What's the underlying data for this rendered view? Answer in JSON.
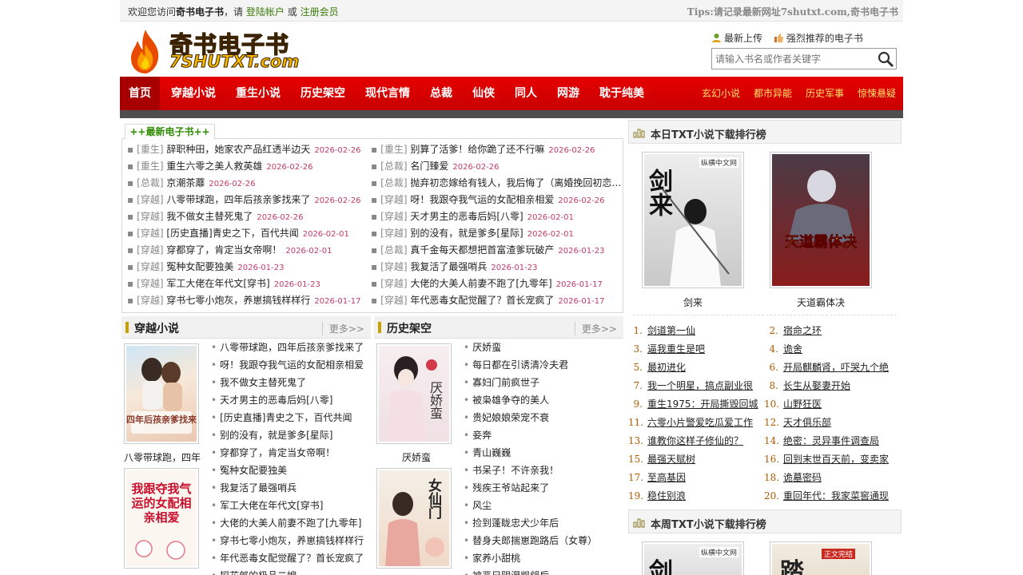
{
  "topbar": {
    "welcome_prefix": "欢迎您访问",
    "site_name": "奇书电子书",
    "welcome_mid": "，请",
    "login": "登陆帐户",
    "or": "或",
    "register": "注册会员",
    "tips": "Tips:请记录最新网址7shutxt.com,奇书电子书"
  },
  "logo": {
    "line1": "奇书电子书",
    "line2": "7SHUTXT.com"
  },
  "header_links": {
    "latest_upload": "最新上传",
    "recommended": "强烈推荐的电子书"
  },
  "search": {
    "placeholder": "请输入书名或作者关键字"
  },
  "nav": {
    "items": [
      "首页",
      "穿越小说",
      "重生小说",
      "历史架空",
      "现代言情",
      "总裁",
      "仙侠",
      "同人",
      "网游",
      "耽于纯美"
    ],
    "extra": [
      "玄幻小说",
      "都市异能",
      "历史军事",
      "惊悚悬疑"
    ]
  },
  "latest": {
    "tab": "++最新电子书++",
    "rows": [
      [
        {
          "cat": "[重生]",
          "title": "辞职种田，她家农产品红透半边天",
          "date": "2026-02-26"
        },
        {
          "cat": "[重生]",
          "title": "别算了活爹！给你跪了还不行嘛",
          "date": "2026-02-26"
        }
      ],
      [
        {
          "cat": "[重生]",
          "title": "重生六零之美人救英雄",
          "date": "2026-02-26"
        },
        {
          "cat": "[总裁]",
          "title": "名门臻爱",
          "date": "2026-02-26"
        }
      ],
      [
        {
          "cat": "[总裁]",
          "title": "京潮茶蘼",
          "date": "2026-02-26"
        },
        {
          "cat": "[总裁]",
          "title": "抛弃初恋嫁给有钱人，我后悔了（离婚挽回初恋…",
          "date": ""
        }
      ],
      [
        {
          "cat": "[穿越]",
          "title": "八零带球跑，四年后孩亲爹找来了",
          "date": "2026-02-26"
        },
        {
          "cat": "[穿越]",
          "title": "呀！我跟夺我气运的女配相亲相爱",
          "date": "2026-02-26"
        }
      ],
      [
        {
          "cat": "[穿越]",
          "title": "我不做女主替死鬼了",
          "date": "2026-02-26"
        },
        {
          "cat": "[穿越]",
          "title": "天才男主的恶毒后妈[八零]",
          "date": "2026-02-01"
        }
      ],
      [
        {
          "cat": "[穿越]",
          "title": "[历史直播]青史之下，百代共闻",
          "date": "2026-02-01"
        },
        {
          "cat": "[穿越]",
          "title": "别的没有，就是爹多[星际]",
          "date": "2026-02-01"
        }
      ],
      [
        {
          "cat": "[穿越]",
          "title": "穿都穿了，肯定当女帝啊！",
          "date": "2026-02-01"
        },
        {
          "cat": "[总裁]",
          "title": "真千金每天都想把首富渣爹玩破产",
          "date": "2026-01-23"
        }
      ],
      [
        {
          "cat": "[穿越]",
          "title": "冤种女配要独美",
          "date": "2026-01-23"
        },
        {
          "cat": "[穿越]",
          "title": "我复活了最强哨兵",
          "date": "2026-01-23"
        }
      ],
      [
        {
          "cat": "[穿越]",
          "title": "军工大佬在年代文[穿书]",
          "date": "2026-01-23"
        },
        {
          "cat": "[穿越]",
          "title": "大佬的大美人前妻不跑了[九零年]",
          "date": "2026-01-17"
        }
      ],
      [
        {
          "cat": "[穿越]",
          "title": "穿书七零小炮灰，养崽搞钱样样行",
          "date": "2026-01-17"
        },
        {
          "cat": "[穿越]",
          "title": "年代恶毒女配觉醒了？首长宠疯了",
          "date": "2026-01-17"
        }
      ]
    ]
  },
  "sections": [
    {
      "title": "穿越小说",
      "more": "更多>>",
      "covers": [
        {
          "caption": "八零带球跑，四年",
          "text": "四年后孩亲爹找来"
        },
        {
          "caption": "",
          "text": "我跟夺我气运的女配相亲相爱"
        }
      ],
      "items": [
        "八零带球跑，四年后孩亲爹找来了",
        "呀！我跟夺我气运的女配相亲相爱",
        "我不做女主替死鬼了",
        "天才男主的恶毒后妈[八零]",
        "[历史直播]青史之下，百代共闻",
        "别的没有，就是爹多[星际]",
        "穿都穿了，肯定当女帝啊！",
        "冤种女配要独美",
        "我复活了最强哨兵",
        "军工大佬在年代文[穿书]",
        "大佬的大美人前妻不跑了[九零年]",
        "穿书七零小炮灰，养崽搞钱样样行",
        "年代恶毒女配觉醒了？首长宠疯了",
        "探花郎的极品二嫂"
      ]
    },
    {
      "title": "历史架空",
      "more": "更多>>",
      "covers": [
        {
          "caption": "厌娇蛮",
          "text": "厌娇蛮"
        },
        {
          "caption": "",
          "text": "女仙门"
        }
      ],
      "items": [
        "厌娇蛮",
        "每日都在引诱清冷夫君",
        "寡妇门前疯世子",
        "被枭雄争夺的美人",
        "贵妃娘娘荣宠不衰",
        "妾奔",
        "青山巍巍",
        "书呆子！不许亲我！",
        "残疾王爷站起来了",
        "风尘",
        "捡到蓬眬忠犬少年后",
        "替身夫郎揣崽跑路后（女尊）",
        "家养小甜桃",
        "被恶兄阴湿觊觎后"
      ]
    }
  ],
  "daily": {
    "title": "本日TXT小说下载排行榜",
    "covers": [
      {
        "caption": "剑来",
        "text": "剑来",
        "badge": "纵横中文网"
      },
      {
        "caption": "天道霸体决",
        "text": "天道霸体决",
        "badge": ""
      }
    ],
    "ranks": [
      "剑道第一仙",
      "宿命之环",
      "逼我重生是吧",
      "诡舍",
      "最初进化",
      "开局麒麟肾，吓哭九个绝",
      "我一个明星，搞点副业很",
      "长生从娶妻开始",
      "重生1975：开局撕毁回城",
      "山野狂医",
      "六零小片警爱吃瓜爱工作",
      "天才俱乐部",
      "谁教你这样子修仙的？",
      "绝密：灵异事件调查局",
      "最强天赋树",
      "回到末世百天前，变卖家",
      "至高基因",
      "诡墓密码",
      "稳住别浪",
      "重回年代：我家菜窖通现"
    ]
  },
  "weekly": {
    "title": "本周TXT小说下载排行榜",
    "covers": [
      {
        "text": "剑",
        "badge": "纵横中文网"
      },
      {
        "text": "踏",
        "badge": "正文完结"
      }
    ]
  },
  "colors": {
    "nav_red": "#d50000",
    "accent_green": "#3a7d0a",
    "date_pink": "#c03a6a",
    "rank_num": "#b05a00"
  }
}
